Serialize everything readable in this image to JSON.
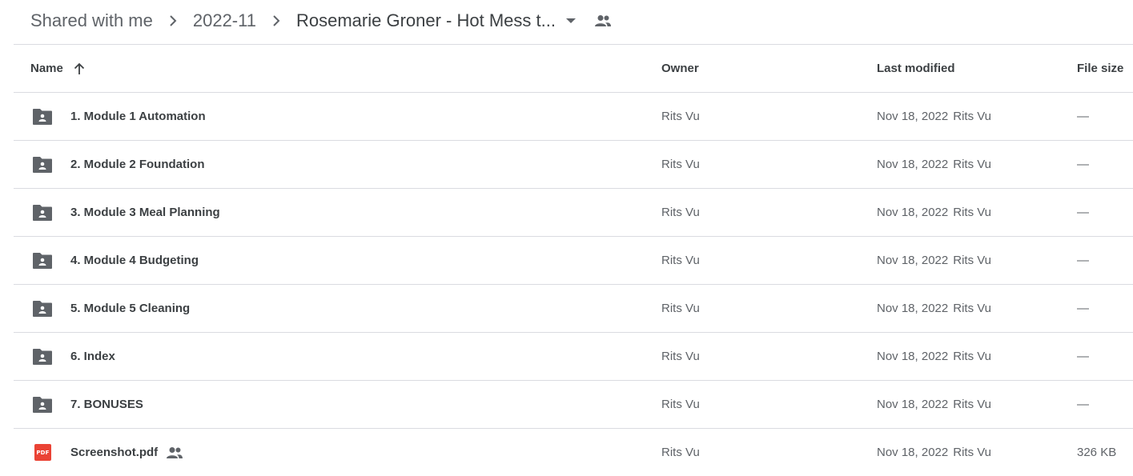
{
  "breadcrumb": {
    "items": [
      "Shared with me",
      "2022-11",
      "Rosemarie Groner - Hot Mess t..."
    ],
    "icons": {
      "separator": "chevron-right-icon",
      "dropdown": "arrow-drop-down-icon",
      "shared": "people-icon"
    }
  },
  "columns": {
    "name": "Name",
    "owner": "Owner",
    "last_modified": "Last modified",
    "file_size": "File size",
    "sort_icon": "arrow-up-icon"
  },
  "files": [
    {
      "name": "1. Module 1 Automation",
      "owner": "Rits Vu",
      "modified_date": "Nov 18, 2022",
      "modified_by": "Rits Vu",
      "size": "—",
      "icon": "shared-folder-icon"
    },
    {
      "name": "2. Module 2 Foundation",
      "owner": "Rits Vu",
      "modified_date": "Nov 18, 2022",
      "modified_by": "Rits Vu",
      "size": "—",
      "icon": "shared-folder-icon"
    },
    {
      "name": "3. Module 3 Meal Planning",
      "owner": "Rits Vu",
      "modified_date": "Nov 18, 2022",
      "modified_by": "Rits Vu",
      "size": "—",
      "icon": "shared-folder-icon"
    },
    {
      "name": "4. Module 4 Budgeting",
      "owner": "Rits Vu",
      "modified_date": "Nov 18, 2022",
      "modified_by": "Rits Vu",
      "size": "—",
      "icon": "shared-folder-icon"
    },
    {
      "name": "5. Module 5 Cleaning",
      "owner": "Rits Vu",
      "modified_date": "Nov 18, 2022",
      "modified_by": "Rits Vu",
      "size": "—",
      "icon": "shared-folder-icon"
    },
    {
      "name": "6. Index",
      "owner": "Rits Vu",
      "modified_date": "Nov 18, 2022",
      "modified_by": "Rits Vu",
      "size": "—",
      "icon": "shared-folder-icon"
    },
    {
      "name": "7. BONUSES",
      "owner": "Rits Vu",
      "modified_date": "Nov 18, 2022",
      "modified_by": "Rits Vu",
      "size": "—",
      "icon": "shared-folder-icon"
    },
    {
      "name": "Screenshot.pdf",
      "owner": "Rits Vu",
      "modified_date": "Nov 18, 2022",
      "modified_by": "Rits Vu",
      "size": "326 KB",
      "icon": "pdf-icon",
      "pdf_label": "PDF",
      "shared": true
    }
  ],
  "colors": {
    "text_primary": "#3c4043",
    "text_secondary": "#5f6368",
    "divider": "#dadce0",
    "folder_icon": "#5f6368",
    "pdf_icon": "#ea4335"
  }
}
